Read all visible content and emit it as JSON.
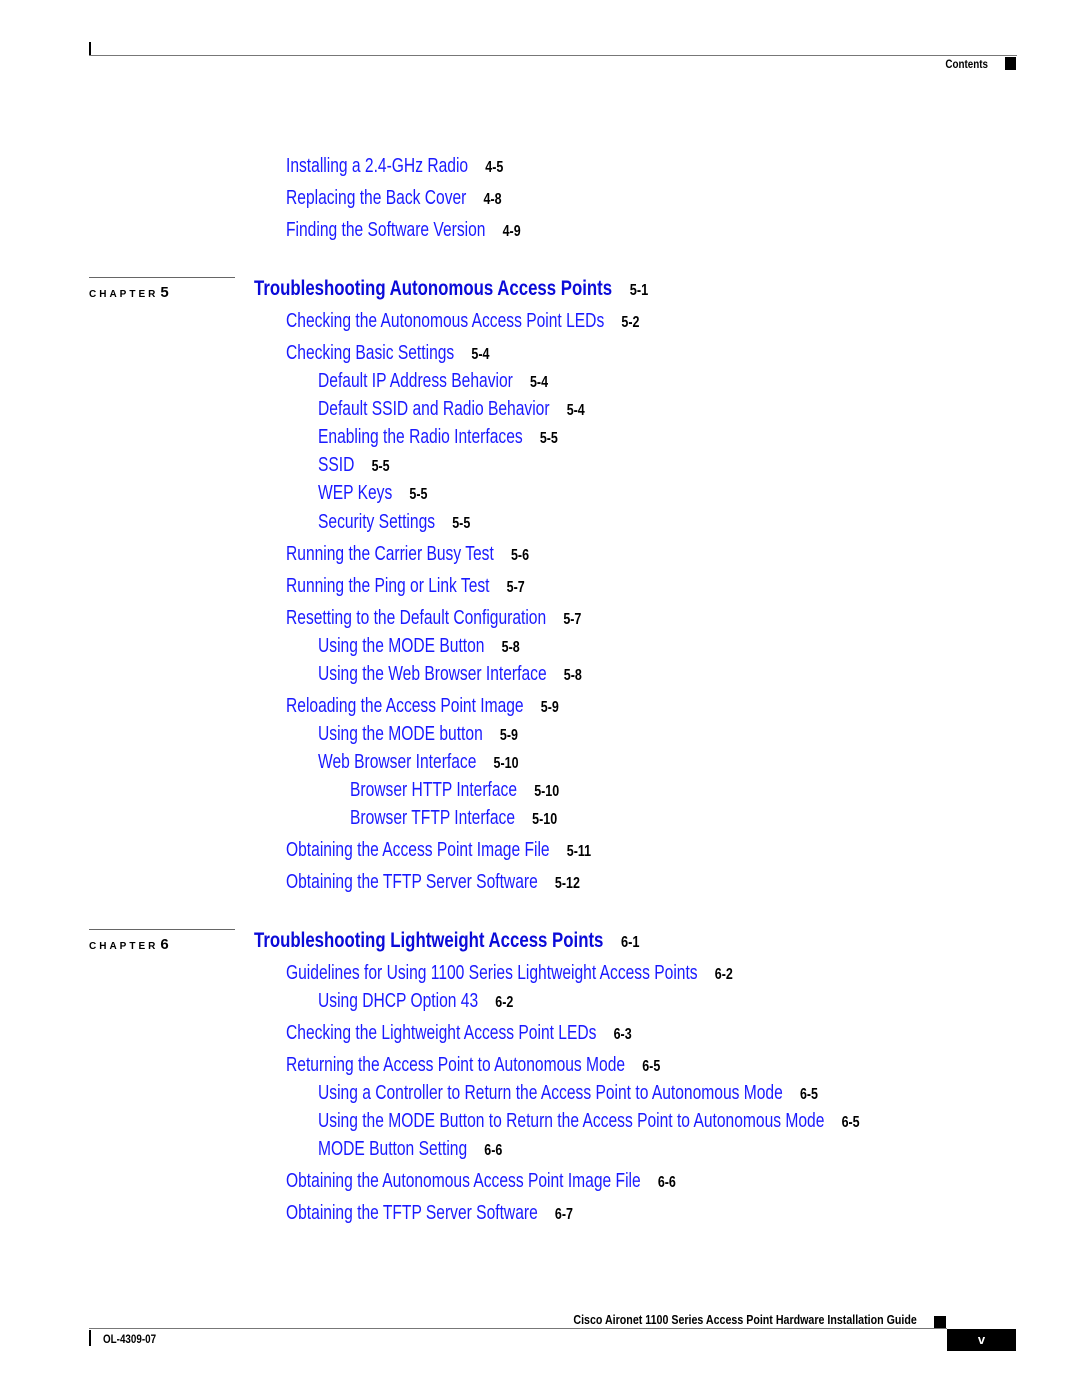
{
  "header": {
    "section_label": "Contents"
  },
  "entries_top": [
    {
      "title": "Installing a 2.4-GHz Radio",
      "page": "4-5"
    },
    {
      "title": "Replacing the Back Cover",
      "page": "4-8"
    },
    {
      "title": "Finding the Software Version",
      "page": "4-9"
    }
  ],
  "chapters": [
    {
      "label": "CHAPTER",
      "number": "5",
      "title": "Troubleshooting Autonomous Access Points",
      "page": "5-1",
      "entries": [
        {
          "title": "Checking the Autonomous Access Point LEDs",
          "page": "5-2",
          "level": 1
        },
        {
          "title": "Checking Basic Settings",
          "page": "5-4",
          "level": 1
        },
        {
          "title": "Default IP Address Behavior",
          "page": "5-4",
          "level": 2
        },
        {
          "title": "Default SSID and Radio Behavior",
          "page": "5-4",
          "level": 2
        },
        {
          "title": "Enabling the Radio Interfaces",
          "page": "5-5",
          "level": 2
        },
        {
          "title": "SSID",
          "page": "5-5",
          "level": 2
        },
        {
          "title": "WEP Keys",
          "page": "5-5",
          "level": 2
        },
        {
          "title": "Security Settings",
          "page": "5-5",
          "level": 2
        },
        {
          "title": "Running the Carrier Busy Test",
          "page": "5-6",
          "level": 1
        },
        {
          "title": "Running the Ping or Link Test",
          "page": "5-7",
          "level": 1
        },
        {
          "title": "Resetting to the Default Configuration",
          "page": "5-7",
          "level": 1
        },
        {
          "title": "Using the MODE Button",
          "page": "5-8",
          "level": 2
        },
        {
          "title": "Using the Web Browser Interface",
          "page": "5-8",
          "level": 2
        },
        {
          "title": "Reloading the Access Point Image",
          "page": "5-9",
          "level": 1
        },
        {
          "title": "Using the MODE button",
          "page": "5-9",
          "level": 2
        },
        {
          "title": "Web Browser Interface",
          "page": "5-10",
          "level": 2
        },
        {
          "title": "Browser HTTP Interface",
          "page": "5-10",
          "level": 3
        },
        {
          "title": "Browser TFTP Interface",
          "page": "5-10",
          "level": 3
        },
        {
          "title": "Obtaining the Access Point Image File",
          "page": "5-11",
          "level": 1
        },
        {
          "title": "Obtaining the TFTP Server Software",
          "page": "5-12",
          "level": 1
        }
      ]
    },
    {
      "label": "CHAPTER",
      "number": "6",
      "title": "Troubleshooting Lightweight Access Points",
      "page": "6-1",
      "entries": [
        {
          "title": "Guidelines for Using 1100 Series Lightweight Access Points",
          "page": "6-2",
          "level": 1
        },
        {
          "title": "Using DHCP Option 43",
          "page": "6-2",
          "level": 2
        },
        {
          "title": "Checking the Lightweight Access Point LEDs",
          "page": "6-3",
          "level": 1
        },
        {
          "title": "Returning the Access Point to Autonomous Mode",
          "page": "6-5",
          "level": 1
        },
        {
          "title": "Using a Controller to Return the Access Point to Autonomous Mode",
          "page": "6-5",
          "level": 2
        },
        {
          "title": "Using the MODE Button to Return the Access Point to Autonomous Mode",
          "page": "6-5",
          "level": 2
        },
        {
          "title": "MODE Button Setting",
          "page": "6-6",
          "level": 2
        },
        {
          "title": "Obtaining the Autonomous Access Point Image File",
          "page": "6-6",
          "level": 1
        },
        {
          "title": "Obtaining the TFTP Server Software",
          "page": "6-7",
          "level": 1
        }
      ]
    }
  ],
  "footer": {
    "guide_title": "Cisco Aironet 1100 Series Access Point Hardware Installation Guide",
    "doc_number": "OL-4309-07",
    "page_number": "v"
  },
  "colors": {
    "link": "#1a1aff",
    "chapter_title": "#0b0bd8",
    "page_ref": "#000000"
  }
}
